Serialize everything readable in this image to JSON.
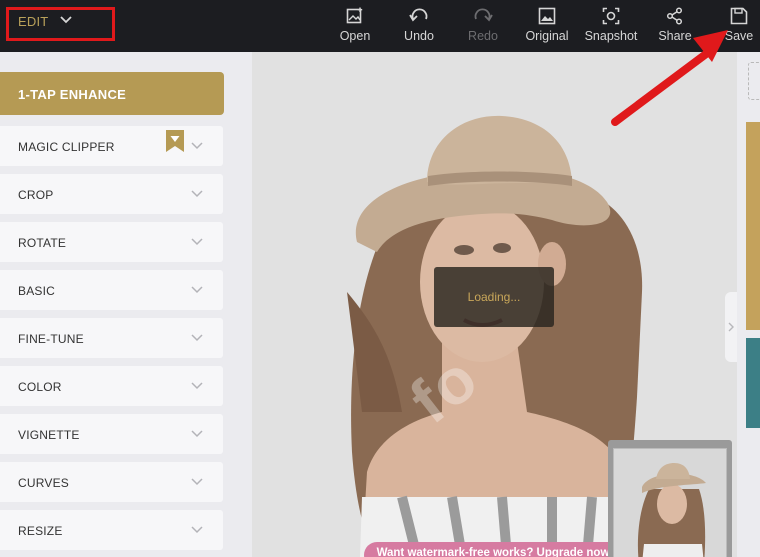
{
  "toolbar": {
    "edit_label": "EDIT",
    "tools": [
      {
        "label": "Open",
        "icon": "open-image-icon",
        "enabled": true
      },
      {
        "label": "Undo",
        "icon": "undo-icon",
        "enabled": true
      },
      {
        "label": "Redo",
        "icon": "redo-icon",
        "enabled": false
      },
      {
        "label": "Original",
        "icon": "original-image-icon",
        "enabled": true
      },
      {
        "label": "Snapshot",
        "icon": "snapshot-icon",
        "enabled": true
      },
      {
        "label": "Share",
        "icon": "share-icon",
        "enabled": true
      },
      {
        "label": "Save",
        "icon": "save-icon",
        "enabled": true
      }
    ]
  },
  "sidebar": {
    "enhance_label": "1-TAP ENHANCE",
    "items": [
      {
        "label": "MAGIC CLIPPER",
        "premium": true
      },
      {
        "label": "CROP"
      },
      {
        "label": "ROTATE"
      },
      {
        "label": "BASIC"
      },
      {
        "label": "FINE-TUNE"
      },
      {
        "label": "COLOR"
      },
      {
        "label": "VIGNETTE"
      },
      {
        "label": "CURVES"
      },
      {
        "label": "RESIZE"
      }
    ]
  },
  "canvas": {
    "loading_text": "Loading...",
    "watermark_text": "fo",
    "upgrade_text": "Want watermark-free works? Upgrade now"
  },
  "colors": {
    "topbar": "#1c1d21",
    "accent_gold": "#b59a54",
    "highlight_red": "#e0191b",
    "upgrade_pink": "#d67ba1"
  }
}
